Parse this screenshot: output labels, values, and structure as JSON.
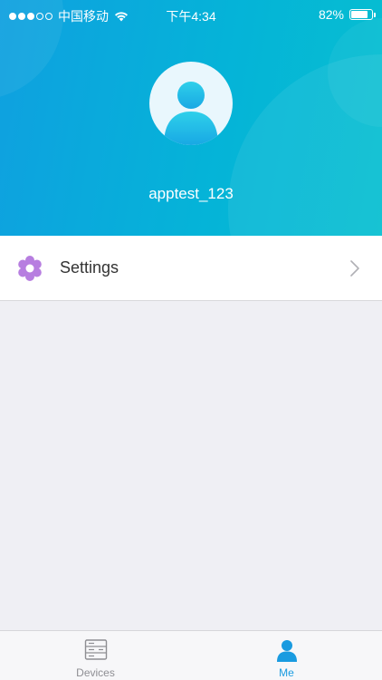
{
  "status_bar": {
    "carrier": "中国移动",
    "time": "下午4:34",
    "battery_percent": "82%",
    "battery_level": 0.82,
    "signal_bars_filled": 3,
    "signal_bars_total": 5
  },
  "profile": {
    "username": "apptest_123",
    "avatar_icon": "user-avatar-icon"
  },
  "menu": {
    "items": [
      {
        "label": "Settings",
        "icon": "gear-icon"
      }
    ]
  },
  "tabbar": {
    "tabs": [
      {
        "label": "Devices",
        "icon": "devices-icon",
        "active": false
      },
      {
        "label": "Me",
        "icon": "person-icon",
        "active": true
      }
    ]
  },
  "colors": {
    "header_start": "#0fa0e0",
    "header_end": "#06bfd0",
    "accent": "#1a9be0",
    "gear": "#b77ee0",
    "background": "#efeff4"
  }
}
